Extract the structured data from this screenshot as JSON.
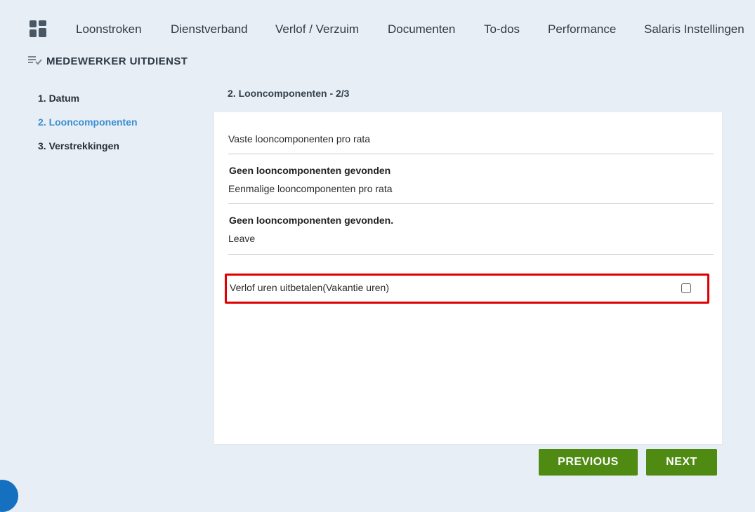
{
  "nav": {
    "items": [
      {
        "label": "Loonstroken"
      },
      {
        "label": "Dienstverband"
      },
      {
        "label": "Verlof / Verzuim"
      },
      {
        "label": "Documenten"
      },
      {
        "label": "To-dos"
      },
      {
        "label": "Performance"
      },
      {
        "label": "Salaris Instellingen"
      }
    ]
  },
  "page": {
    "title": "MEDEWERKER UITDIENST"
  },
  "steps": [
    {
      "label": "1. Datum",
      "active": false
    },
    {
      "label": "2. Looncomponenten",
      "active": true
    },
    {
      "label": "3. Verstrekkingen",
      "active": false
    }
  ],
  "section": {
    "heading": "2. Looncomponenten - 2/3"
  },
  "card": {
    "fixed_title": "Vaste looncomponenten pro rata",
    "fixed_empty": "Geen looncomponenten gevonden",
    "onetime_title": "Eenmalige looncomponenten pro rata",
    "onetime_empty": "Geen looncomponenten gevonden.",
    "leave_title": "Leave",
    "payout_label": "Verlof uren uitbetalen(Vakantie uren)",
    "payout_checked": false
  },
  "buttons": {
    "previous": "PREVIOUS",
    "next": "NEXT"
  },
  "colors": {
    "background": "#e8eef5",
    "accent_blue": "#3a8fd0",
    "button_green": "#4f8a12",
    "highlight_red": "#e00000"
  },
  "icons": {
    "dashboard": "grid-icon",
    "header": "list-check-icon"
  }
}
